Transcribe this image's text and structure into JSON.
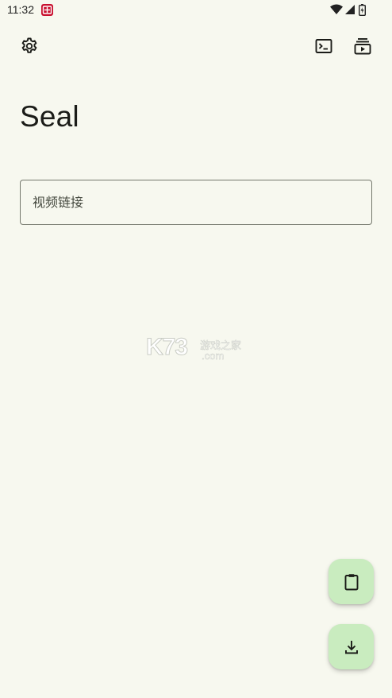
{
  "status_bar": {
    "time": "11:32",
    "app_icon": "red-app-icon",
    "icons": [
      "wifi-icon",
      "signal-icon",
      "battery-icon"
    ]
  },
  "toolbar": {
    "settings_icon": "gear-icon",
    "terminal_icon": "terminal-icon",
    "queue_icon": "playlist-video-icon"
  },
  "main": {
    "title": "Seal",
    "url_placeholder": "视频链接",
    "url_value": ""
  },
  "watermark": {
    "brand": "K73",
    "tagline": "游戏之家",
    "domain": ".com"
  },
  "fabs": {
    "paste_icon": "clipboard-icon",
    "download_icon": "download-icon"
  },
  "colors": {
    "background": "#f7f8ef",
    "fab_container": "#c9ecbf",
    "outline": "#75786d",
    "on_surface": "#1b1c18"
  }
}
